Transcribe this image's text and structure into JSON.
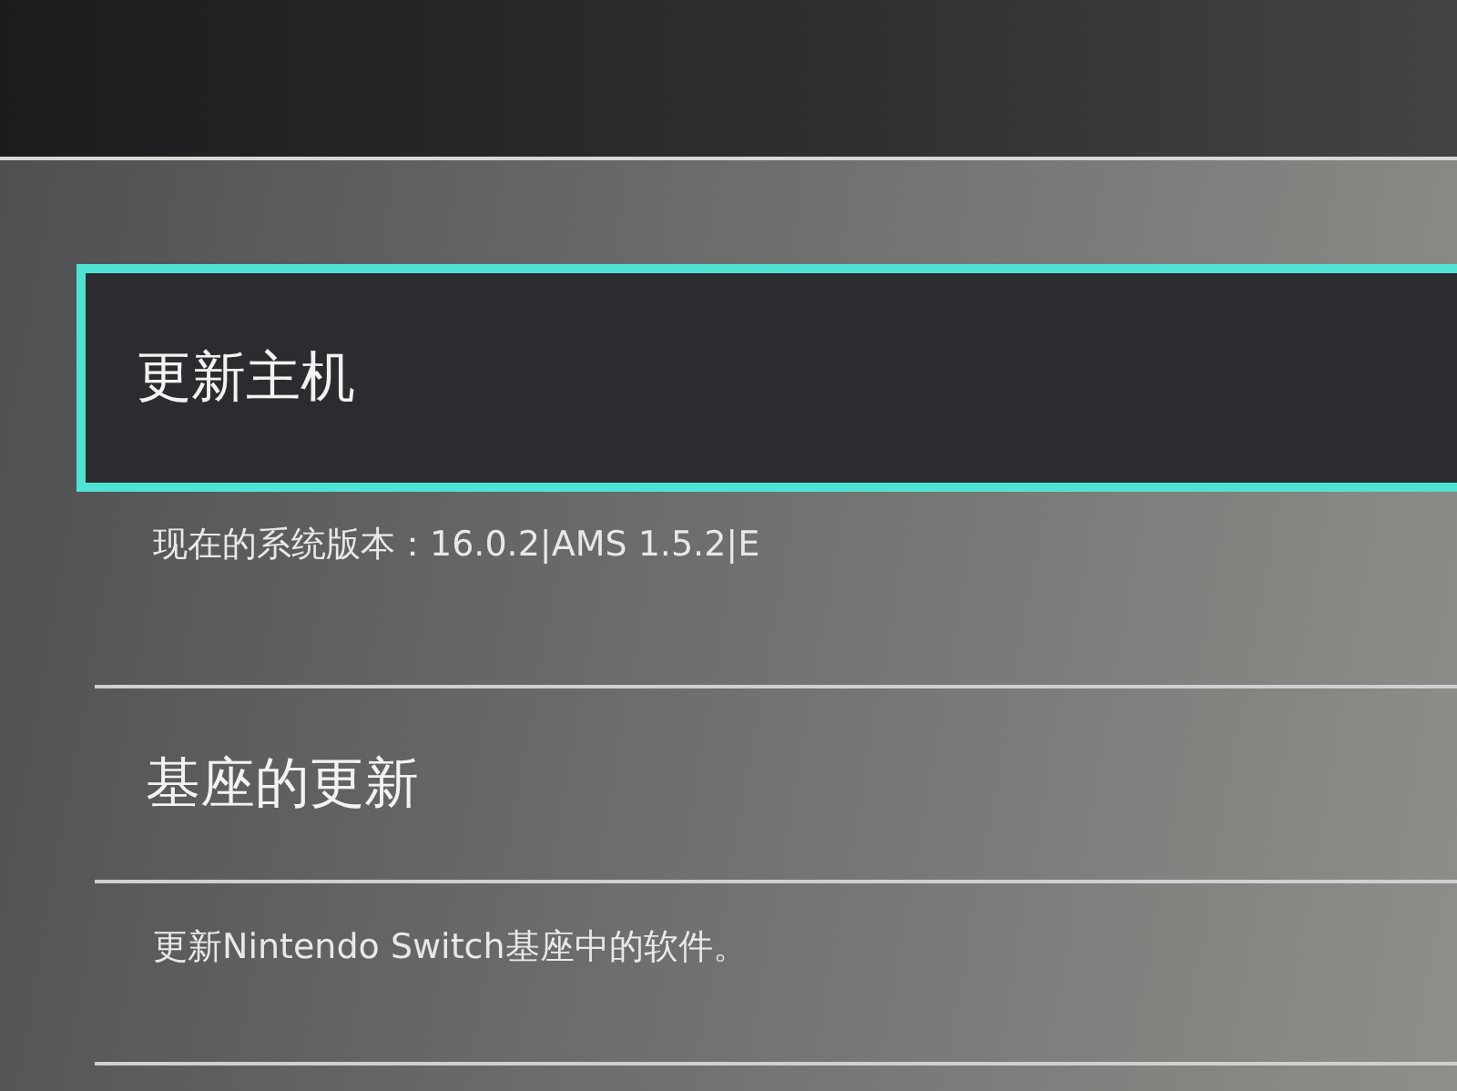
{
  "settings": [
    {
      "title": "更新主机",
      "selected": true,
      "description": "现在的系统版本：16.0.2|AMS 1.5.2|E"
    },
    {
      "title": "基座的更新",
      "selected": false,
      "description": "更新Nintendo Switch基座中的软件。"
    }
  ]
}
